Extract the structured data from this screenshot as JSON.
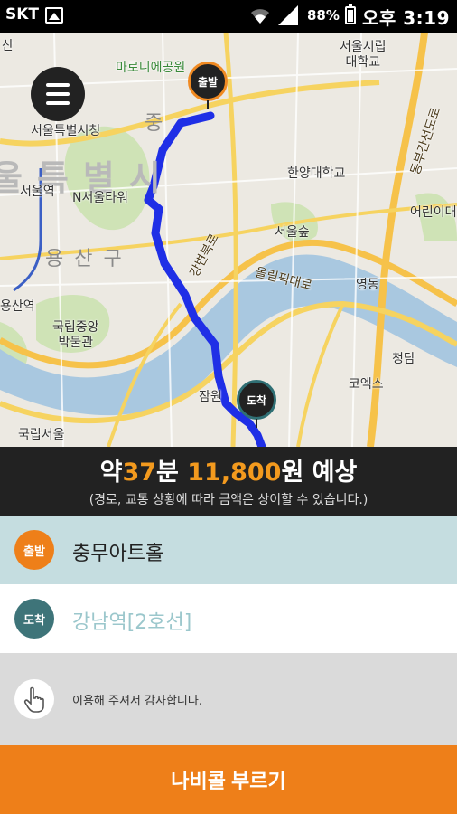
{
  "status_bar": {
    "carrier": "SKT",
    "battery": "88%",
    "time": "오후 3:19"
  },
  "map": {
    "labels": {
      "seoul_city_hall": "서울특별시청",
      "seoul_station": "서울역",
      "n_seoul_tower": "N서울타워",
      "yongsan_station": "용산역",
      "national_museum": "국립중앙\n박물관",
      "national_seoul": "국립서울",
      "hanyang_univ": "한양대학교",
      "seoul_forest": "서울숲",
      "city_univ": "서울시립\n대학교",
      "children_park": "어린이대",
      "yeongdong": "영동",
      "cheongdam": "청담",
      "coex": "코엑스",
      "jamwon": "잠원",
      "marroni": "마로니에공원",
      "olympic_road": "올림픽대로",
      "expressway": "강변북로",
      "dongbu": "동부간선도로",
      "district_big": "울특별시",
      "district_yongsan": "용산구",
      "jung": "중",
      "san": "산"
    },
    "start_pin": "출발",
    "end_pin": "도착"
  },
  "estimate": {
    "prefix": "약",
    "minutes": "37",
    "minute_unit": "분",
    "fare": "11,800",
    "fare_unit": "원 예상",
    "note": "(경로, 교통 상황에 따라 금액은 상이할 수 있습니다.)"
  },
  "origin": {
    "badge": "출발",
    "name": "충무아트홀"
  },
  "destination": {
    "badge": "도착",
    "name": "강남역[2호선]"
  },
  "message": {
    "icon": "touch-hand-icon",
    "text": "이용해 주셔서 감사합니다."
  },
  "call_button": "나비콜 부르기",
  "colors": {
    "accent": "#ee7f19",
    "route": "#1f2fe6",
    "destination": "#3e7479",
    "origin_row_bg": "#c5dde0"
  }
}
